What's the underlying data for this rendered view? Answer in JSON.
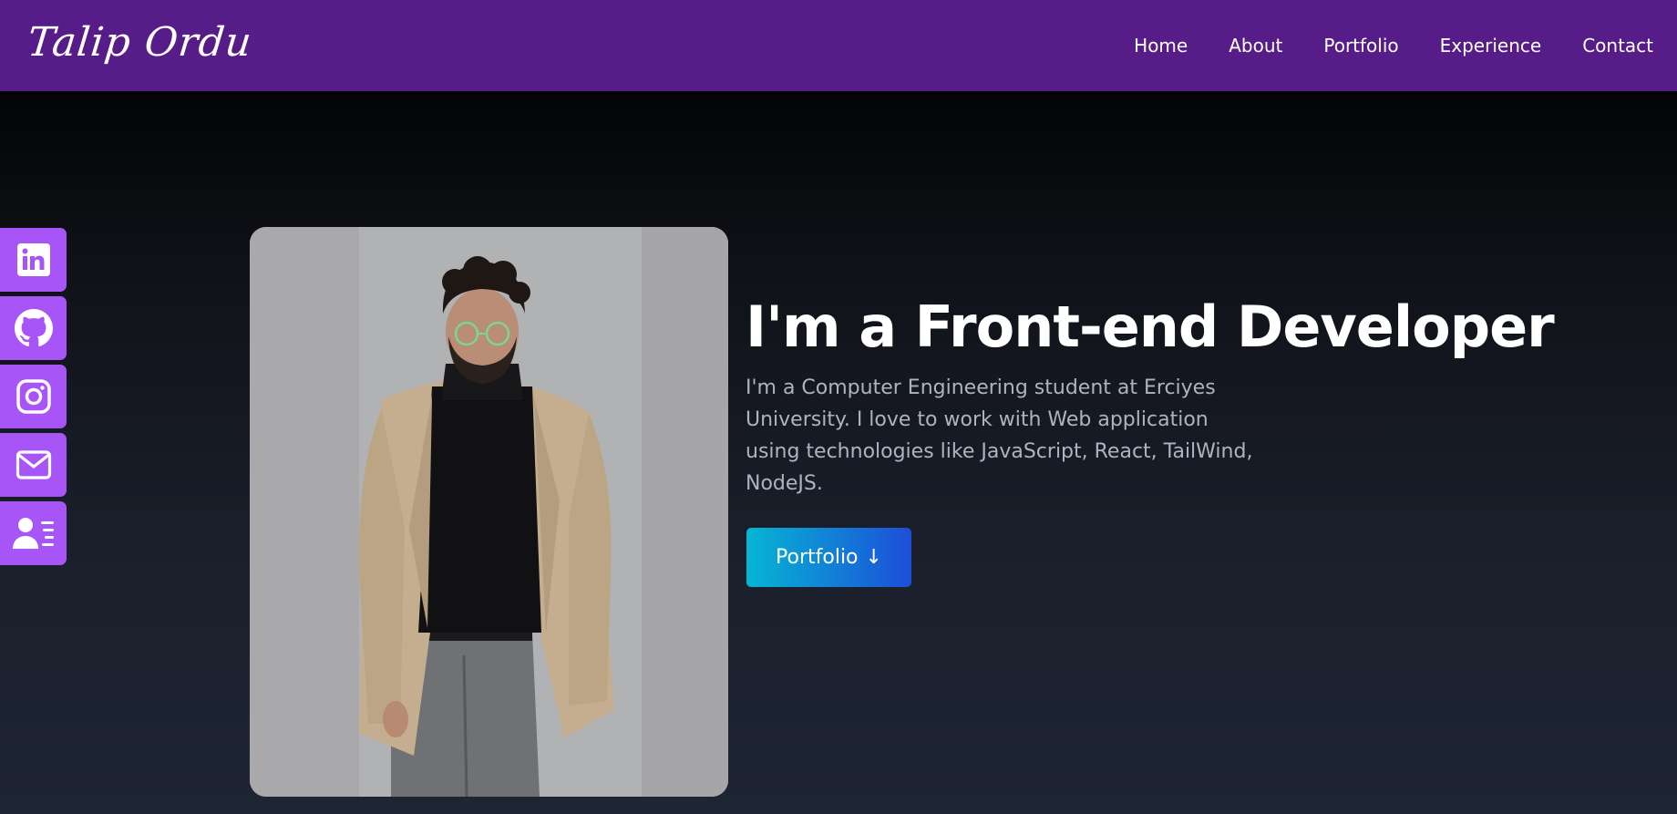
{
  "header": {
    "logo_text": "Talip Ordu",
    "nav": [
      "Home",
      "About",
      "Portfolio",
      "Experience",
      "Contact"
    ]
  },
  "social": {
    "items": [
      {
        "icon": "linkedin-icon"
      },
      {
        "icon": "github-icon"
      },
      {
        "icon": "instagram-icon"
      },
      {
        "icon": "mail-icon"
      },
      {
        "icon": "resume-icon"
      }
    ]
  },
  "hero": {
    "title": "I'm a Front-end Developer",
    "description": "I'm a Computer Engineering student at Erciyes University. I love to work with Web application using technologies like JavaScript, React, TailWind, NodeJS.",
    "button_label": "Portfolio",
    "button_icon": "↓"
  },
  "colors": {
    "navbar": "#561c87",
    "social_bg": "#a855f7",
    "cta_gradient_start": "#06b6d4",
    "cta_gradient_end": "#1d4ed8",
    "body_text": "#aeb4bf"
  }
}
